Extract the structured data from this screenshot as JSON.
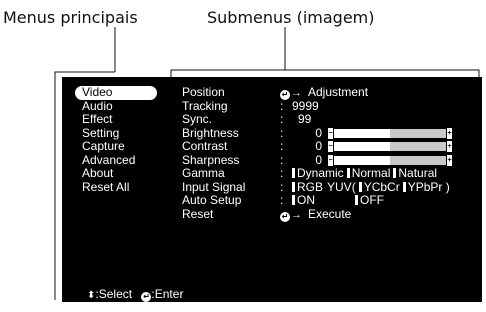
{
  "callouts": {
    "main_menus": "Menus principais",
    "submenus": "Submenus (imagem)"
  },
  "main_menu": {
    "active_index": 0,
    "items": [
      "Video",
      "Audio",
      "Effect",
      "Setting",
      "Capture",
      "Advanced",
      "About",
      "Reset All"
    ]
  },
  "submenu": {
    "names": [
      "Position",
      "Tracking",
      "Sync.",
      "Brightness",
      "Contrast",
      "Sharpness",
      "Gamma",
      "Input Signal",
      "Auto Setup",
      "Reset"
    ],
    "position_action": "Adjustment",
    "tracking_value": "9999",
    "sync_value": "99",
    "brightness_value": "0",
    "contrast_value": "0",
    "sharpness_value": "0",
    "slider_level": 0.5,
    "gamma_options": [
      "Dynamic",
      "Normal",
      "Natural"
    ],
    "input_signal_options": [
      "RGB",
      "YUV(",
      "YCbCr",
      "YPbPr )"
    ],
    "auto_setup_options": [
      "ON",
      "OFF"
    ],
    "reset_action": "Execute",
    "colon": ":"
  },
  "footer": {
    "select_label": ":Select",
    "enter_label": ":Enter"
  },
  "colors": {
    "osd_background": "#000000",
    "osd_text": "#ffffff",
    "slider_track": "#c8c8c8"
  }
}
